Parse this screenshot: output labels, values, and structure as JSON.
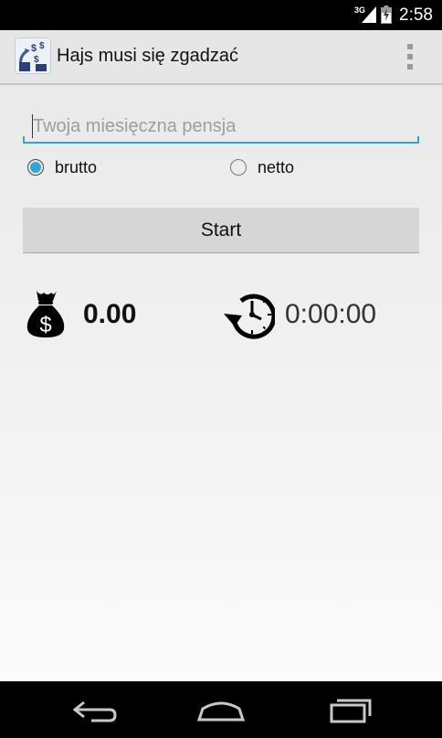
{
  "status_bar": {
    "network": "3G",
    "time": "2:58",
    "icons": [
      "signal-icon",
      "battery-icon"
    ]
  },
  "action_bar": {
    "title": "Hajs musi się zgadzać",
    "app_icon": "app-money-icon",
    "overflow_icon": "overflow-menu-icon"
  },
  "salary_input": {
    "placeholder": "Twoja miesięczna pensja",
    "value": ""
  },
  "pay_type": {
    "options": [
      {
        "label": "brutto",
        "checked": true
      },
      {
        "label": "netto",
        "checked": false
      }
    ]
  },
  "start_button": {
    "label": "Start"
  },
  "money": {
    "icon": "money-bag-icon",
    "value": "0.00"
  },
  "timer": {
    "icon": "timer-icon",
    "value": "0:00:00"
  },
  "nav_bar": {
    "icons": [
      "back-icon",
      "home-icon",
      "recents-icon"
    ]
  },
  "colors": {
    "accent": "#33a4d8",
    "button": "#d6d6d6",
    "action_bar": "#e6e6e6"
  }
}
